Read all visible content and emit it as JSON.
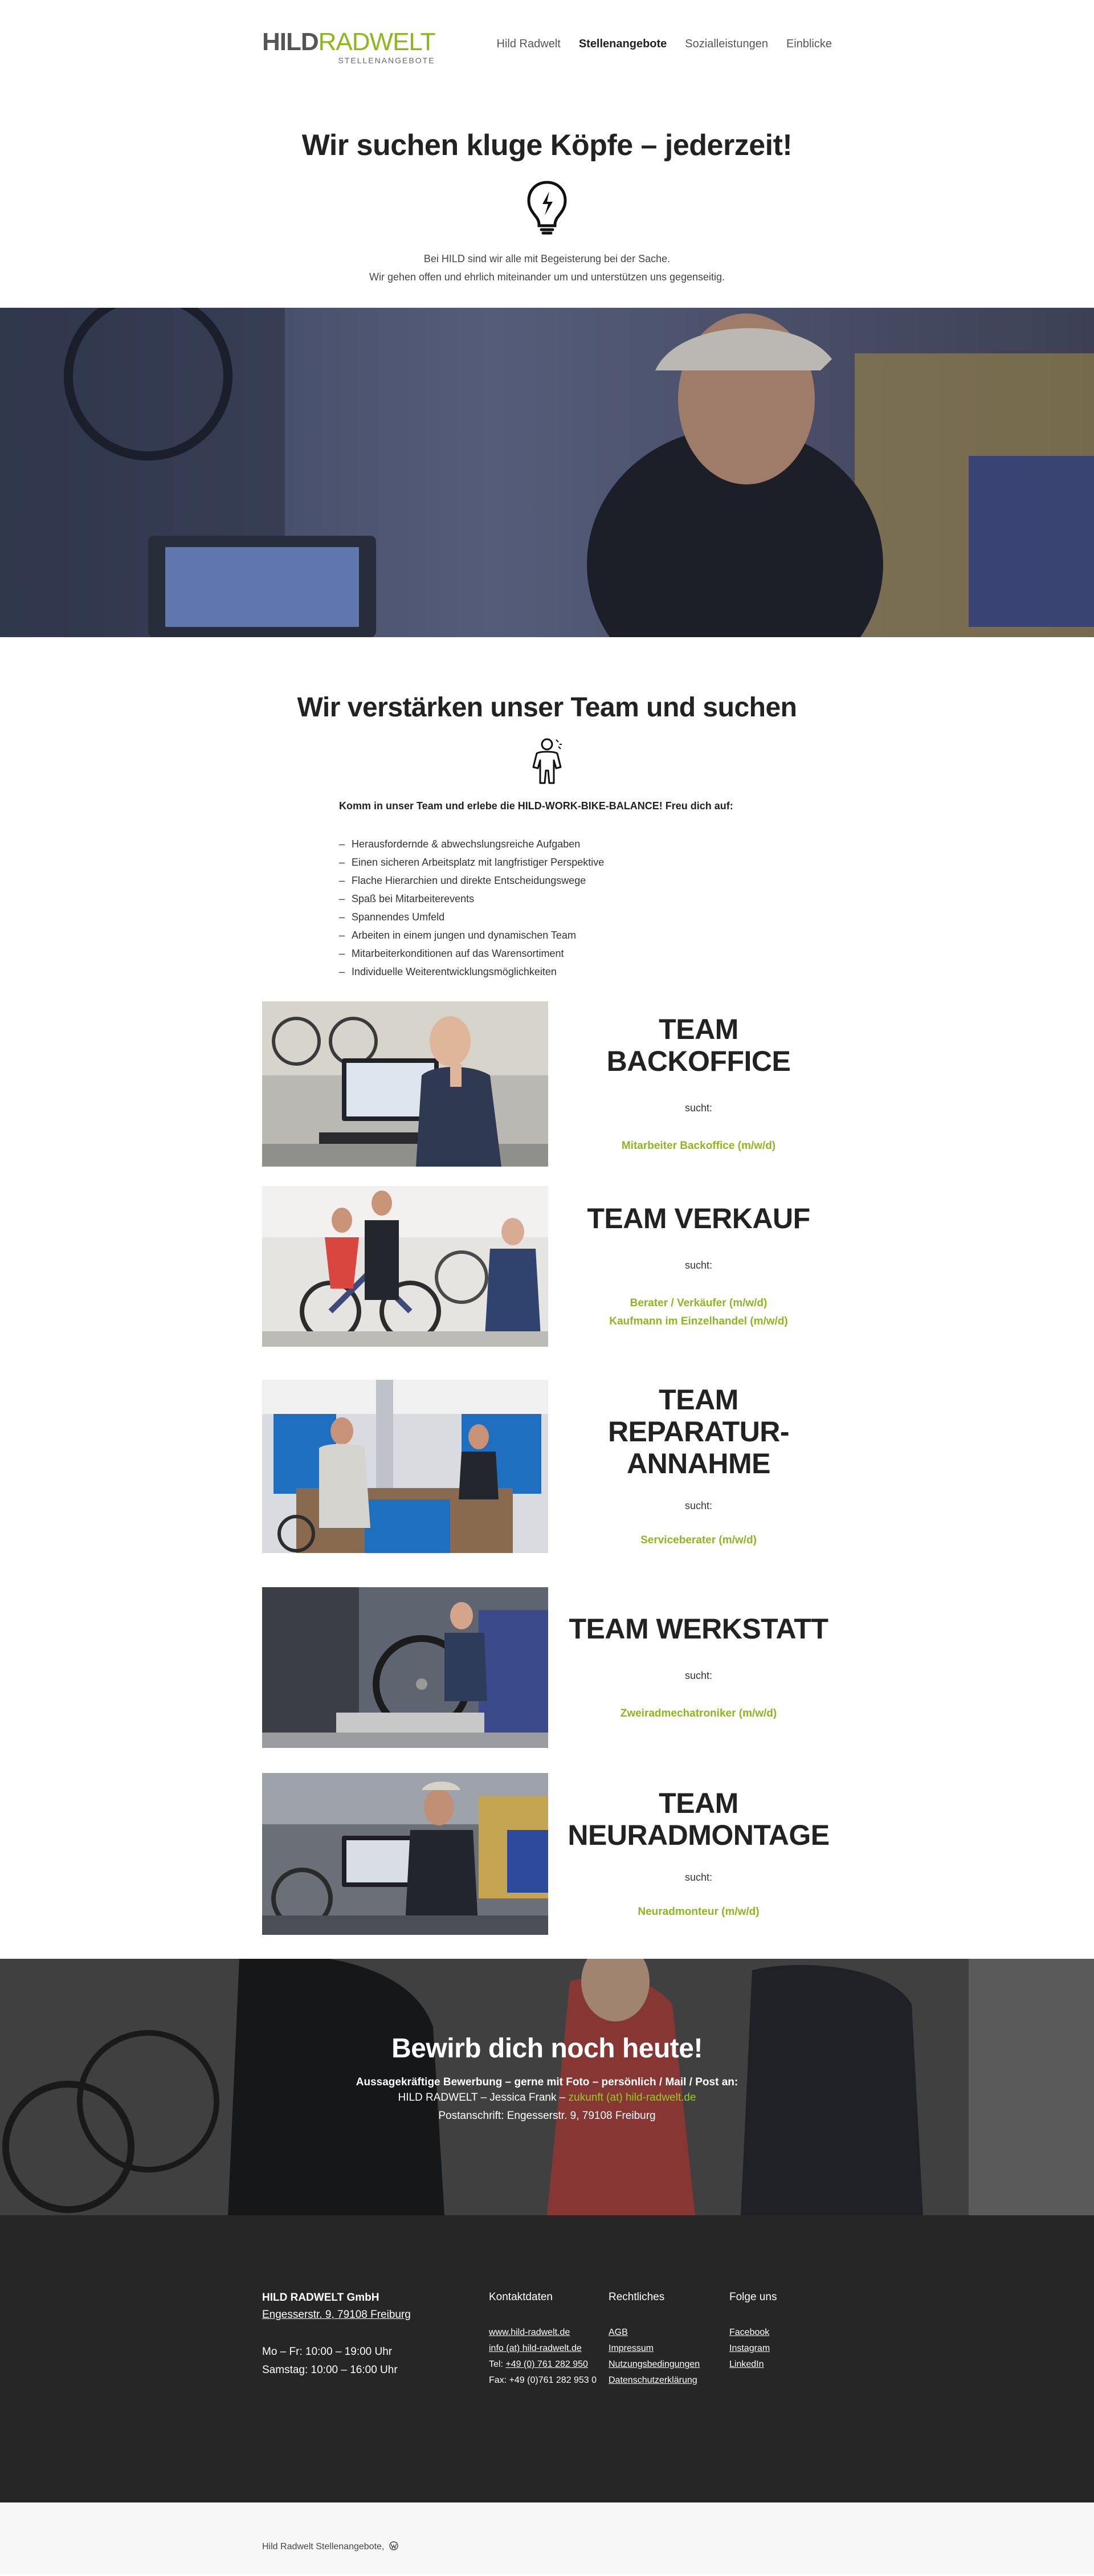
{
  "header": {
    "logo_hild": "HILD",
    "logo_radwelt": "RADWELT",
    "logo_sub": "STELLENANGEBOTE",
    "nav": [
      "Hild Radwelt",
      "Stellenangebote",
      "Sozialleistungen",
      "Einblicke"
    ],
    "active_nav": "Stellenangebote"
  },
  "intro": {
    "title": "Wir suchen kluge Köpfe – jederzeit!",
    "icon": "lightbulb-icon",
    "line1": "Bei HILD sind wir alle mit Begeisterung bei der Sache.",
    "line2": "Wir gehen offen und ehrlich miteinander um und unterstützen uns gegenseitig."
  },
  "team": {
    "title": "Wir verstärken unser Team und suchen",
    "icon": "person-icon",
    "lead": "Komm in unser Team und erlebe die HILD-WORK-BIKE-BALANCE! Freu dich auf:",
    "benefits": [
      "Herausfordernde & abwechslungsreiche Aufgaben",
      "Einen sicheren Arbeitsplatz mit langfristiger Perspektive",
      "Flache Hierarchien und direkte Entscheidungswege",
      "Spaß bei Mitarbeiterevents",
      "Spannendes Umfeld",
      "Arbeiten in einem jungen und dynamischen Team",
      "Mitarbeiterkonditionen auf das Warensortiment",
      "Individuelle Weiterentwicklungsmöglichkeiten"
    ]
  },
  "teams": [
    {
      "name_lines": [
        "TEAM BACKOFFICE"
      ],
      "sucht": "sucht:",
      "jobs": [
        "Mitarbeiter Backoffice (m/w/d)"
      ]
    },
    {
      "name_lines": [
        "TEAM VERKAUF"
      ],
      "sucht": "sucht:",
      "jobs": [
        "Berater / Verkäufer (m/w/d)",
        "Kaufmann im Einzelhandel (m/w/d)"
      ]
    },
    {
      "name_lines": [
        "TEAM",
        "REPARATUR-",
        "ANNAHME"
      ],
      "sucht": "sucht:",
      "jobs": [
        "Serviceberater (m/w/d)"
      ]
    },
    {
      "name_lines": [
        "TEAM WERKSTATT"
      ],
      "sucht": "sucht:",
      "jobs": [
        "Zweiradmechatroniker (m/w/d)"
      ]
    },
    {
      "name_lines": [
        "TEAM",
        "NEURADMONTAGE"
      ],
      "sucht": "sucht:",
      "jobs": [
        "Neuradmonteur (m/w/d)"
      ]
    }
  ],
  "apply": {
    "title": "Bewirb dich noch heute!",
    "line1": "Aussagekräftige Bewerbung – gerne mit Foto – persönlich / Mail / Post an:",
    "line2_prefix": "HILD RADWELT – Jessica Frank – ",
    "email": "zukunft (at) hild-radwelt.de",
    "line3": "Postanschrift: Engesserstr. 9, 79108 Freiburg"
  },
  "footer": {
    "company": "HILD RADWELT GmbH",
    "address": "Engesserstr. 9, 79108 Freiburg",
    "hours1": "Mo – Fr: 10:00 – 19:00 Uhr",
    "hours2": "Samstag: 10:00 – 16:00 Uhr",
    "kontakt_title": "Kontaktdaten",
    "website": "www.hild-radwelt.de",
    "mail": "info (at) hild-radwelt.de",
    "tel_prefix": "Tel: ",
    "tel": "+49 (0) 761 282 950",
    "fax": "Fax: +49 (0)761 282 953 0",
    "recht_title": "Rechtliches",
    "recht_links": [
      "AGB",
      "Impressum",
      "Nutzungsbedingungen",
      "Datenschutzerklärung"
    ],
    "social_title": "Folge uns",
    "social_links": [
      "Facebook",
      "Instagram",
      "LinkedIn"
    ],
    "copyright": "Hild Radwelt Stellenangebote,",
    "wp_icon": "wordpress-icon"
  },
  "colors": {
    "accent": "#8db620",
    "dark": "#262626",
    "text": "#333333"
  }
}
